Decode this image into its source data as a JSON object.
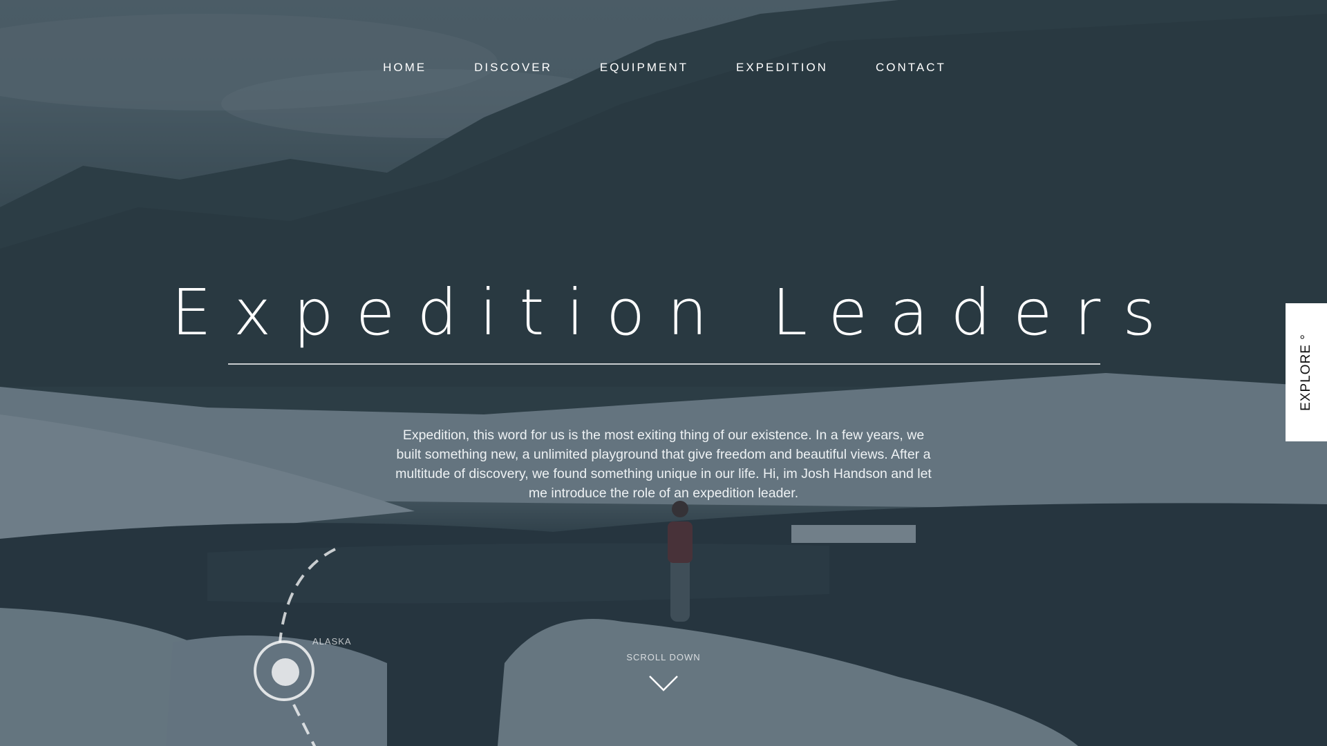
{
  "nav": {
    "items": [
      {
        "label": "HOME"
      },
      {
        "label": "DISCOVER"
      },
      {
        "label": "EQUIPMENT"
      },
      {
        "label": "EXPEDITION"
      },
      {
        "label": "CONTACT"
      }
    ]
  },
  "hero": {
    "title": "Expedition Leaders",
    "description": "Expedition, this word for us is the most exiting thing of our existence. In a few years, we built something new, a unlimited playground that give freedom and beautiful views. After a multitude of discovery, we found something unique in our life. Hi, im Josh Handson and let me introduce the role of an expedition leader."
  },
  "location": {
    "label": "ALASKA"
  },
  "scroll": {
    "label": "SCROLL DOWN",
    "icon": "chevron-down-icon"
  },
  "side_tab": {
    "label": "EXPLORE °"
  },
  "colors": {
    "overlay": "#2c3e4a",
    "text": "#ffffff",
    "tab_background": "#ffffff",
    "tab_text": "#111111"
  }
}
